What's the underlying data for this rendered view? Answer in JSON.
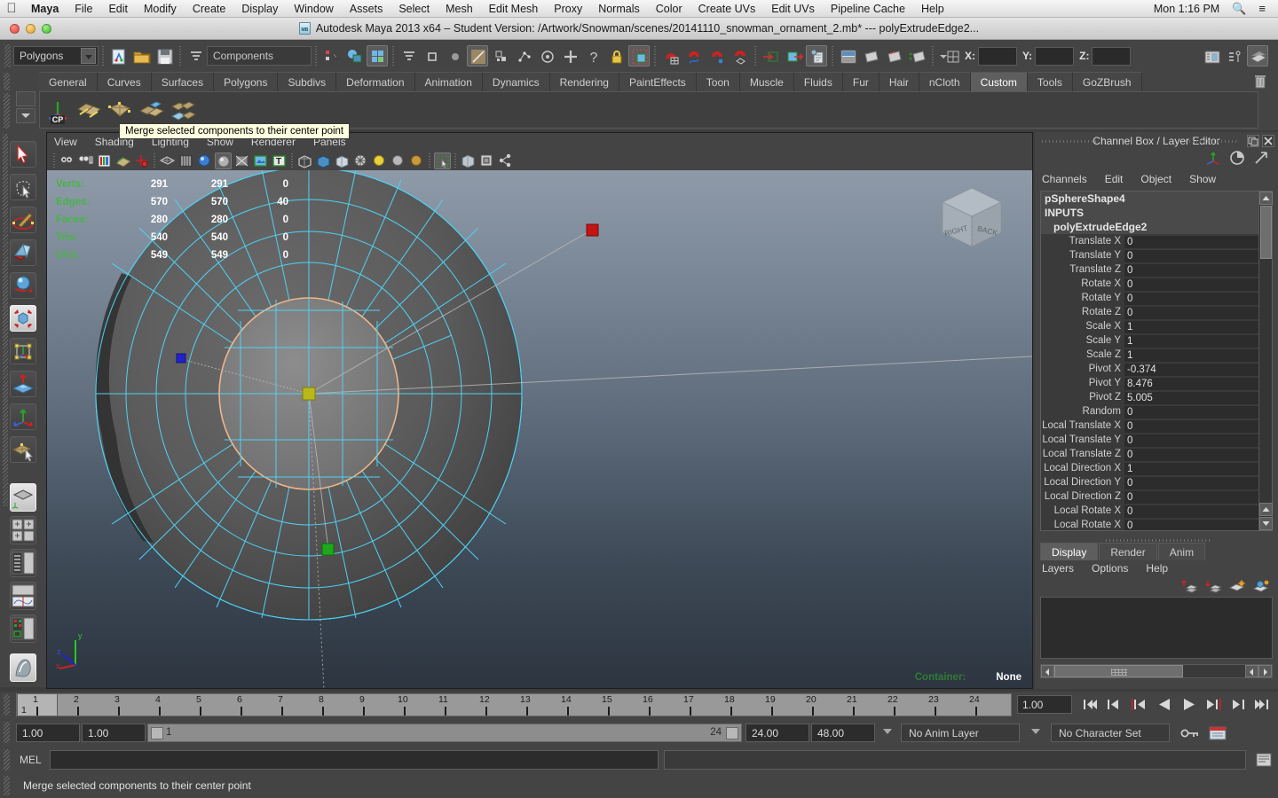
{
  "os_menubar": {
    "apple_icon": "apple-icon",
    "items": [
      "Maya",
      "File",
      "Edit",
      "Modify",
      "Create",
      "Display",
      "Window",
      "Assets",
      "Select",
      "Mesh",
      "Edit Mesh",
      "Proxy",
      "Normals",
      "Color",
      "Create UVs",
      "Edit UVs",
      "Pipeline Cache",
      "Help"
    ],
    "clock": "Mon 1:16 PM",
    "search_icon": "search-icon",
    "list_icon": "list-icon"
  },
  "titlebar": {
    "text": "Autodesk Maya 2013 x64 – Student Version: /Artwork/Snowman/scenes/20141110_snowman_ornament_2.mb*   ---   polyExtrudeEdge2..."
  },
  "status_line": {
    "menuset": "Polygons",
    "component_field": "Components",
    "coord_labels": [
      "X:",
      "Y:",
      "Z:"
    ],
    "coord_values": [
      "",
      "",
      ""
    ]
  },
  "shelf": {
    "tabs": [
      "General",
      "Curves",
      "Surfaces",
      "Polygons",
      "Subdivs",
      "Deformation",
      "Animation",
      "Dynamics",
      "Rendering",
      "PaintEffects",
      "Toon",
      "Muscle",
      "Fluids",
      "Fur",
      "Hair",
      "nCloth",
      "Custom",
      "Tools",
      "GoZBrush"
    ],
    "selected_tab": "Custom",
    "buttons": [
      "CP",
      "merge-edge-tool",
      "merge-vertex-tool",
      "extrude-face-tool",
      "detach-component-tool"
    ],
    "first_button_label": "CP",
    "trash_icon": "trash-icon"
  },
  "tooltip": {
    "text": "Merge selected components to their center point"
  },
  "toolbox": {
    "tools": [
      {
        "name": "select-tool"
      },
      {
        "name": "lasso-select-tool"
      },
      {
        "name": "paint-select-tool"
      },
      {
        "name": "move-tool"
      },
      {
        "name": "rotate-tool"
      },
      {
        "name": "scale-tool"
      },
      {
        "name": "universal-manipulator-tool"
      },
      {
        "name": "soft-modification-tool"
      },
      {
        "name": "show-manipulator-tool"
      },
      {
        "name": "last-tool-used"
      }
    ],
    "layouts": [
      {
        "name": "single-perspective-layout"
      },
      {
        "name": "four-view-layout"
      },
      {
        "name": "outliner-persp-layout"
      },
      {
        "name": "persp-graph-layout"
      },
      {
        "name": "hypershade-persp-layout"
      },
      {
        "name": "maya-logo"
      }
    ]
  },
  "viewport": {
    "panel_menus": [
      "View",
      "Shading",
      "Lighting",
      "Show",
      "Renderer",
      "Panels"
    ],
    "hud": {
      "rows": [
        {
          "label": "Verts:",
          "c1": "291",
          "c2": "291",
          "c3": "0"
        },
        {
          "label": "Edges:",
          "c1": "570",
          "c2": "570",
          "c3": "40"
        },
        {
          "label": "Faces:",
          "c1": "280",
          "c2": "280",
          "c3": "0"
        },
        {
          "label": "Tris:",
          "c1": "540",
          "c2": "540",
          "c3": "0"
        },
        {
          "label": "UVs:",
          "c1": "549",
          "c2": "549",
          "c3": "0"
        }
      ]
    },
    "viewcube": {
      "face_left": "RIGHT",
      "face_right": "BACK"
    },
    "axis_gizmo": {
      "x": "x",
      "y": "y",
      "z": "z"
    },
    "container_label": "Container:",
    "container_value": "None",
    "colors": {
      "wireframe": "#4fd2f5",
      "selected_edge": "#f0b68a",
      "manip_x": "#c41414",
      "manip_y": "#1ea81e",
      "manip_center": "#b8b81a",
      "vertex_unselected": "#2222cc"
    }
  },
  "channel_box": {
    "title": "Channel Box / Layer Editor",
    "menus": [
      "Channels",
      "Edit",
      "Object",
      "Show"
    ],
    "node_name": "pSphereShape4",
    "section": "INPUTS",
    "input_node": "polyExtrudeEdge2",
    "attributes": [
      {
        "name": "Translate X",
        "value": "0"
      },
      {
        "name": "Translate Y",
        "value": "0"
      },
      {
        "name": "Translate Z",
        "value": "0"
      },
      {
        "name": "Rotate X",
        "value": "0"
      },
      {
        "name": "Rotate Y",
        "value": "0"
      },
      {
        "name": "Rotate Z",
        "value": "0"
      },
      {
        "name": "Scale X",
        "value": "1"
      },
      {
        "name": "Scale Y",
        "value": "1"
      },
      {
        "name": "Scale Z",
        "value": "1"
      },
      {
        "name": "Pivot X",
        "value": "-0.374"
      },
      {
        "name": "Pivot Y",
        "value": "8.476"
      },
      {
        "name": "Pivot Z",
        "value": "5.005"
      },
      {
        "name": "Random",
        "value": "0"
      },
      {
        "name": "Local Translate X",
        "value": "0"
      },
      {
        "name": "Local Translate Y",
        "value": "0"
      },
      {
        "name": "Local Translate Z",
        "value": "0"
      },
      {
        "name": "Local Direction X",
        "value": "1"
      },
      {
        "name": "Local Direction Y",
        "value": "0"
      },
      {
        "name": "Local Direction Z",
        "value": "0"
      },
      {
        "name": "Local Rotate X",
        "value": "0"
      },
      {
        "name": "Local Rotate X",
        "value": "0"
      }
    ]
  },
  "layer_editor": {
    "tabs": [
      "Display",
      "Render",
      "Anim"
    ],
    "selected_tab": "Display",
    "menus": [
      "Layers",
      "Options",
      "Help"
    ],
    "icons": [
      "move-layer-up-icon",
      "move-layer-down-icon",
      "new-layer-icon",
      "new-layer-from-selected-icon"
    ]
  },
  "time_slider": {
    "ticks": [
      "1",
      "2",
      "3",
      "4",
      "5",
      "6",
      "7",
      "8",
      "9",
      "10",
      "11",
      "12",
      "13",
      "14",
      "15",
      "16",
      "17",
      "18",
      "19",
      "20",
      "21",
      "22",
      "23",
      "24"
    ],
    "current_frame": "1",
    "current_frame_field": "1.00",
    "playback_buttons": [
      "go-to-start-icon",
      "step-back-key-icon",
      "step-back-frame-icon",
      "play-backwards-icon",
      "play-forwards-icon",
      "step-forward-frame-icon",
      "step-forward-key-icon",
      "go-to-end-icon"
    ]
  },
  "range_slider": {
    "anim_start": "1.00",
    "range_start": "1.00",
    "range_bar_start": "1",
    "range_bar_end": "24",
    "range_end": "24.00",
    "anim_end": "48.00",
    "anim_layer": "No Anim Layer",
    "character_set": "No Character Set",
    "key_icon": "key-icon",
    "autokey_icon": "auto-keyframe-icon"
  },
  "command_line": {
    "label": "MEL",
    "input_value": "",
    "output_value": "",
    "script_editor_icon": "script-editor-icon"
  },
  "help_line": {
    "text": "Merge selected components to their center point"
  }
}
